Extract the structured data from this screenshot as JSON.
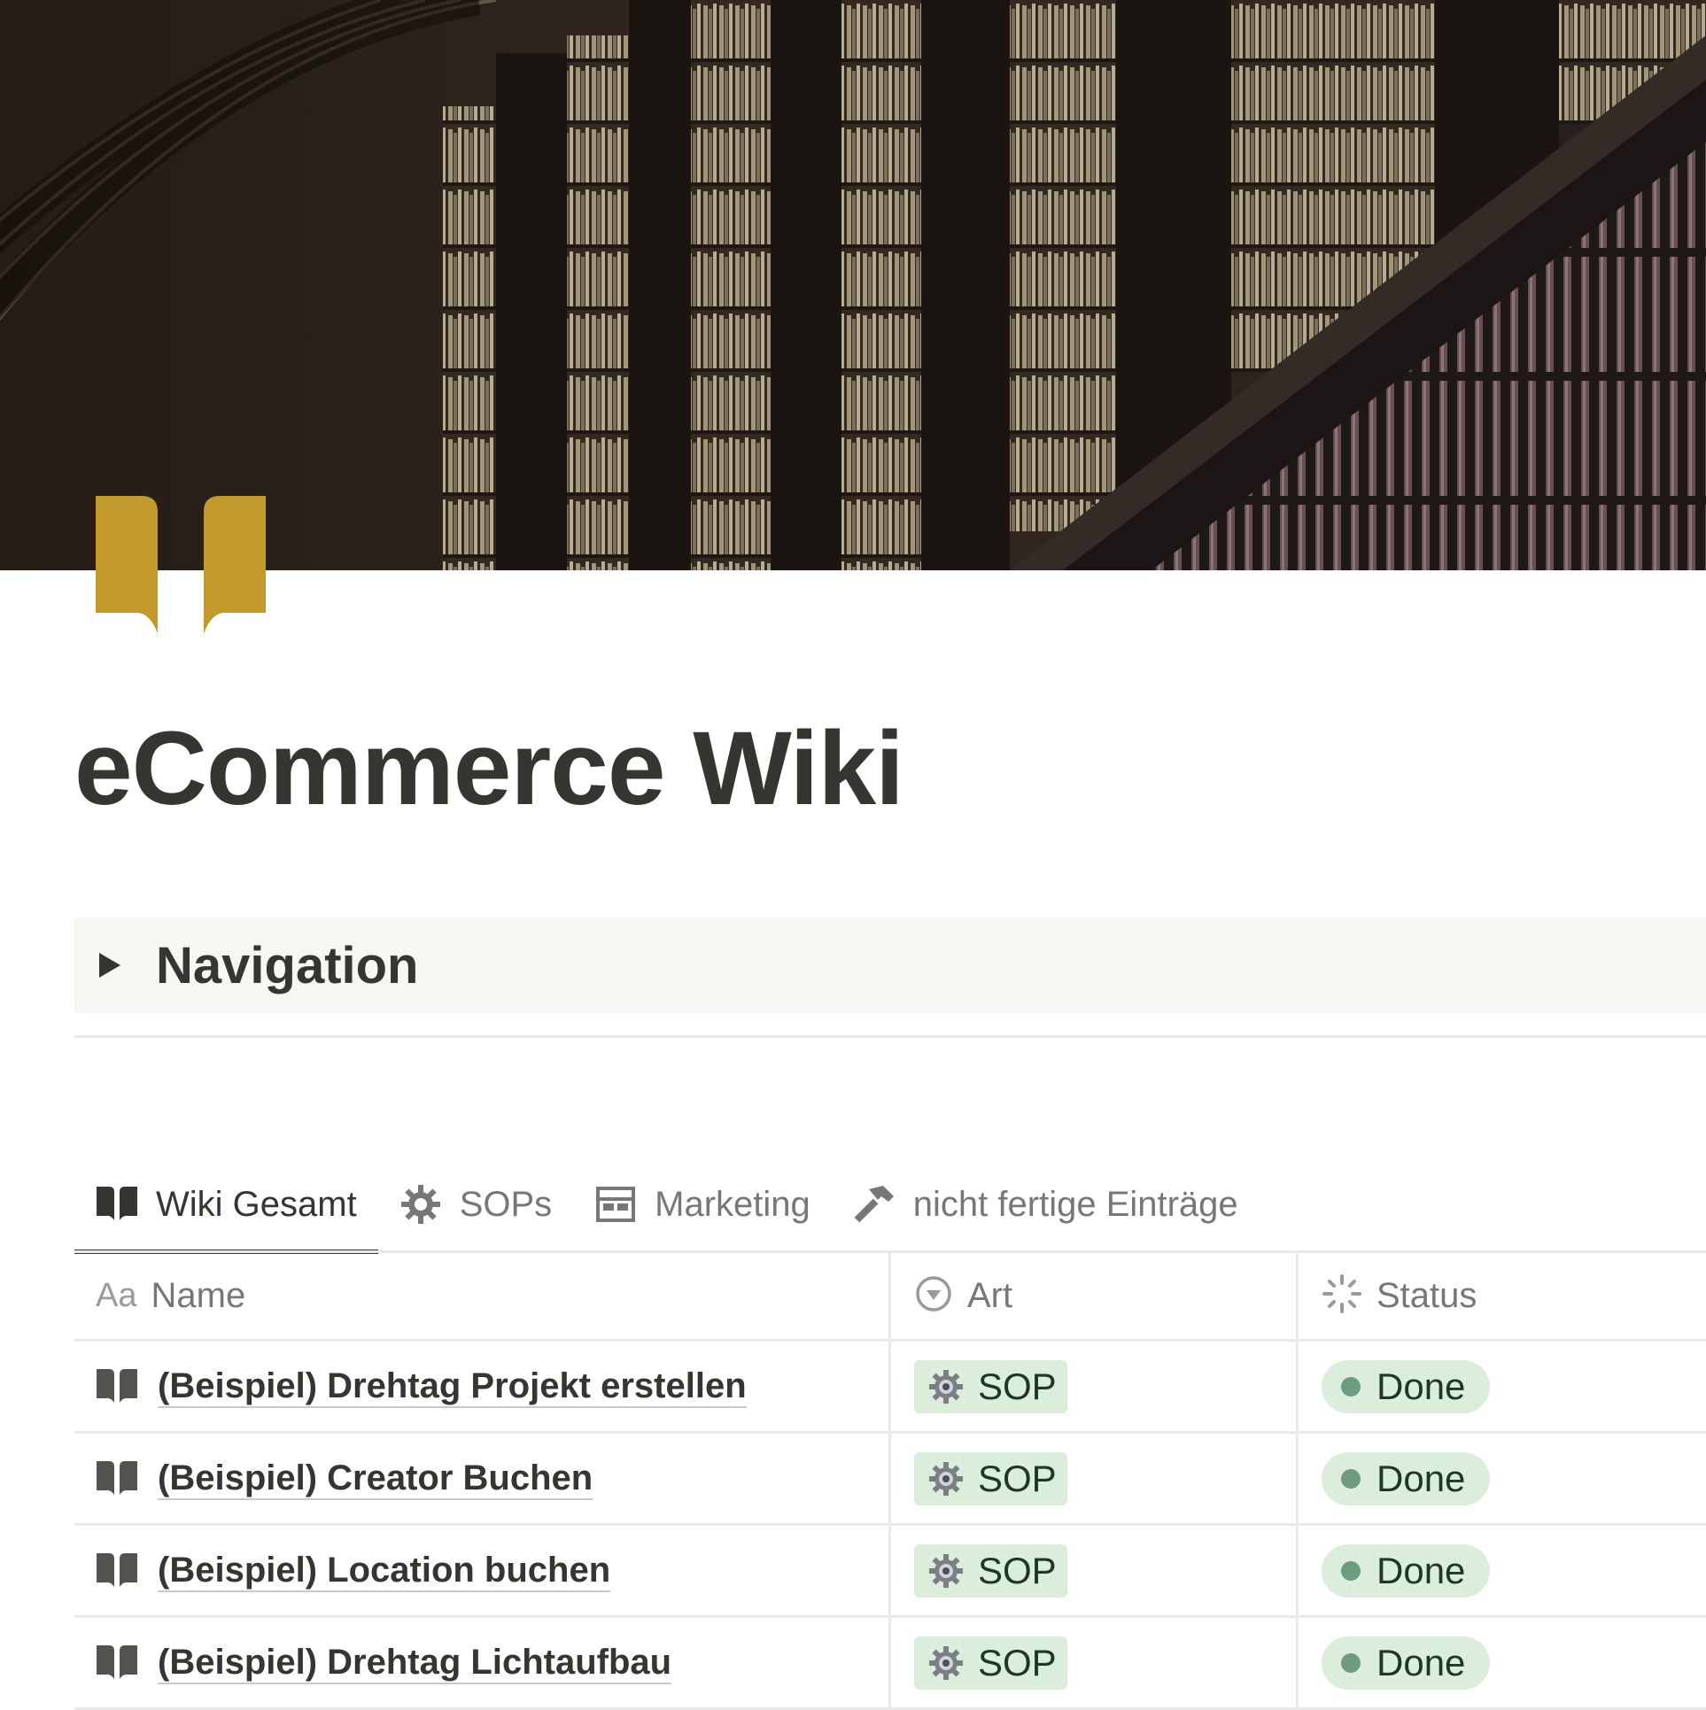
{
  "page": {
    "title": "eCommerce Wiki",
    "icon": "book-icon",
    "cover": "library-cover-image"
  },
  "toggle": {
    "label": "Navigation",
    "icon": "triangle-right-icon"
  },
  "tabs": [
    {
      "label": "Wiki Gesamt",
      "icon": "book-icon",
      "active": true
    },
    {
      "label": "SOPs",
      "icon": "gear-icon",
      "active": false
    },
    {
      "label": "Marketing",
      "icon": "board-icon",
      "active": false
    },
    {
      "label": "nicht fertige Einträge",
      "icon": "hammer-icon",
      "active": false
    }
  ],
  "table": {
    "columns": [
      {
        "label": "Name",
        "icon": "text-aa-icon",
        "icon_text": "Aa"
      },
      {
        "label": "Art",
        "icon": "select-icon"
      },
      {
        "label": "Status",
        "icon": "status-loader-icon"
      }
    ],
    "rows": [
      {
        "name": "(Beispiel) Drehtag Projekt erstellen",
        "art": "SOP",
        "status": "Done"
      },
      {
        "name": "(Beispiel) Creator Buchen",
        "art": "SOP",
        "status": "Done"
      },
      {
        "name": "(Beispiel) Location buchen",
        "art": "SOP",
        "status": "Done"
      },
      {
        "name": "(Beispiel) Drehtag Lichtaufbau",
        "art": "SOP",
        "status": "Done"
      }
    ]
  },
  "colors": {
    "text": "#37352f",
    "muted": "#787774",
    "icon_gold": "#c19a2b",
    "tag_green_bg": "#dbeddb",
    "status_dot": "#6c9b7d",
    "toggle_bg": "#f7f6f3"
  }
}
